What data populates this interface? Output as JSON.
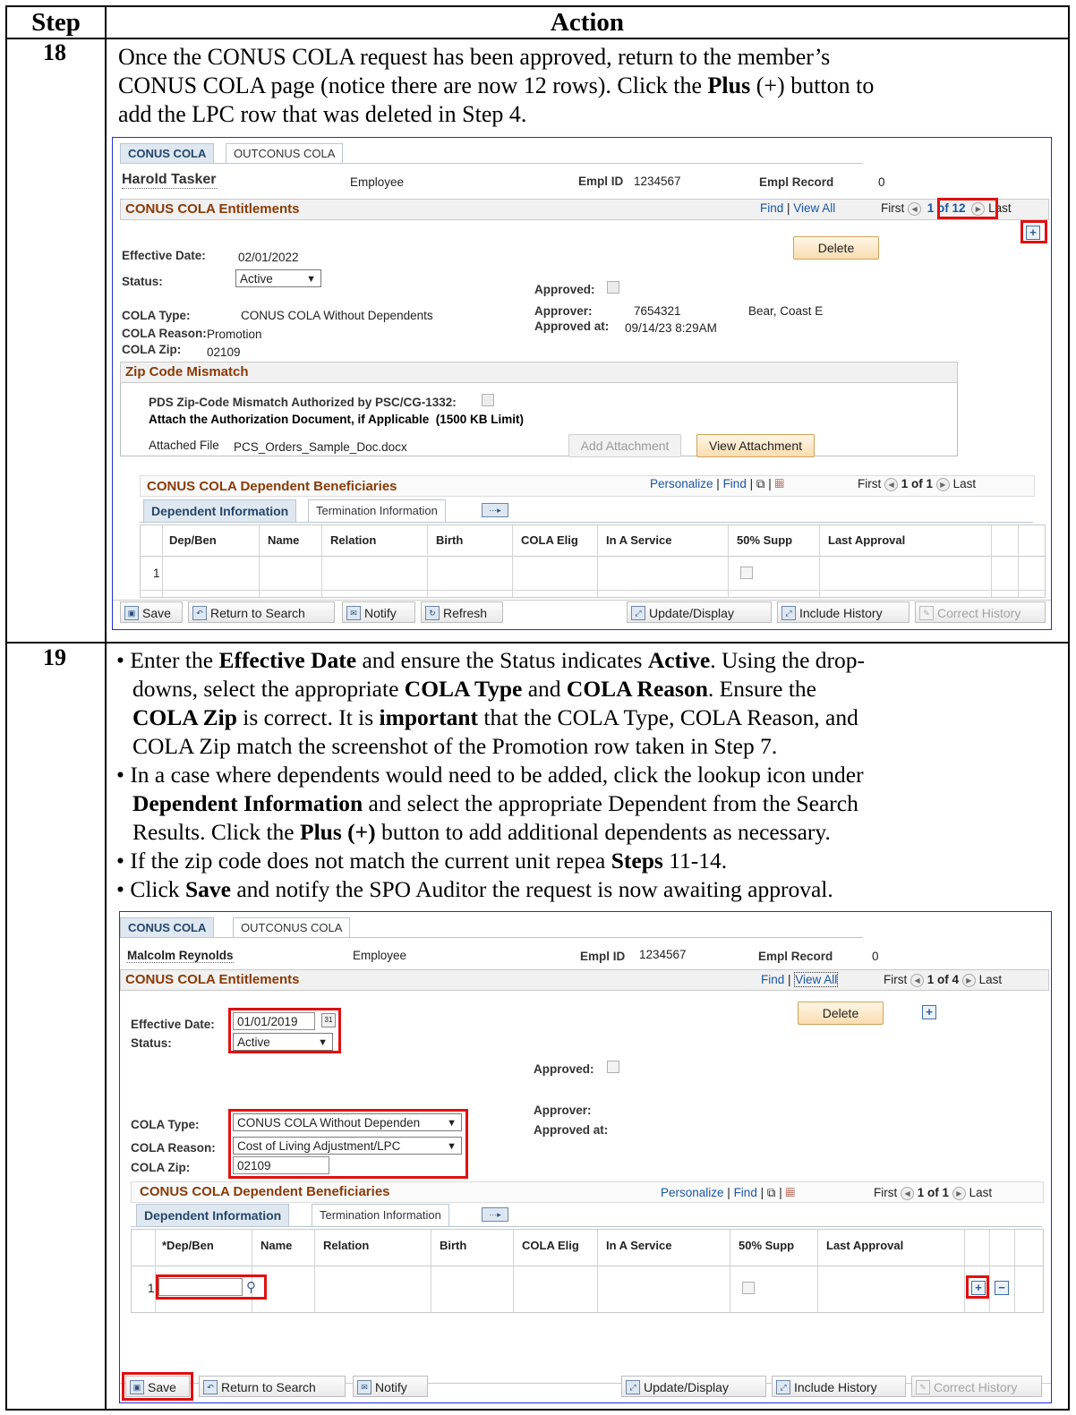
{
  "table": {
    "col_step": "Step",
    "col_action": "Action"
  },
  "step18": {
    "number": "18",
    "line1": "Once the CONUS COLA request has been approved, return to the member’s",
    "line2a": "CONUS COLA page (notice there are now 12 rows).  Click the ",
    "line2b": "Plus",
    "line2c": " (+) button to",
    "line3": "add the LPC row that was deleted in Step 4.",
    "shot": {
      "tab1": "CONUS COLA",
      "tab2": "OUTCONUS COLA",
      "name": "Harold Tasker",
      "employee": "Employee",
      "empl_id_label": "Empl ID",
      "empl_id": "1234567",
      "empl_record_label": "Empl Record",
      "empl_record": "0",
      "section_title": "CONUS COLA Entitlements",
      "find": "Find",
      "view_all": "View All",
      "first": "First",
      "counter": "1 of 12",
      "last": "Last",
      "delete": "Delete",
      "eff_date_label": "Effective Date:",
      "eff_date": "02/01/2022",
      "status_label": "Status:",
      "status": "Active",
      "approved_label": "Approved:",
      "cola_type_label": "COLA Type:",
      "cola_type": "CONUS COLA Without Dependents",
      "approver_label": "Approver:",
      "approver_id": "7654321",
      "approver_name": "Bear, Coast E",
      "cola_reason_label": "COLA Reason:",
      "cola_reason": "Promotion",
      "approved_at_label": "Approved at:",
      "approved_at": "09/14/23  8:29AM",
      "cola_zip_label": "COLA Zip:",
      "cola_zip": "02109",
      "zip_section": "Zip Code Mismatch",
      "pds_label": "PDS Zip-Code Mismatch Authorized by PSC/CG-1332:",
      "attach_doc": "Attach the Authorization Document, if Applicable",
      "kb_limit": "(1500 KB Limit)",
      "attached_file_label": "Attached File",
      "attached_file": "PCS_Orders_Sample_Doc.docx",
      "add_attachment": "Add Attachment",
      "view_attachment": "View Attachment",
      "dep_section": "CONUS COLA Dependent Beneficiaries",
      "personalize": "Personalize",
      "find2": "Find",
      "first2": "First",
      "counter2": "1 of 1",
      "last2": "Last",
      "subtab1": "Dependent Information",
      "subtab2": "Termination Information",
      "cols": [
        "Dep/Ben",
        "Name",
        "Relation",
        "Birth",
        "COLA Elig",
        "In A Service",
        "50% Supp",
        "Last Approval"
      ],
      "row_num": "1",
      "save": "Save",
      "return_to_search": "Return to Search",
      "notify": "Notify",
      "refresh": "Refresh",
      "update_display": "Update/Display",
      "include_history": "Include History",
      "correct_history": "Correct History"
    }
  },
  "step19": {
    "number": "19",
    "b1_l1a": "Enter the ",
    "b1_l1b": "Effective Date",
    "b1_l1c": " and ensure the Status indicates ",
    "b1_l1d": "Active",
    "b1_l1e": ".  Using the drop-",
    "b1_l2a": "downs, select the appropriate ",
    "b1_l2b": "COLA Type",
    "b1_l2c": " and ",
    "b1_l2d": "COLA Reason",
    "b1_l2e": ".  Ensure the",
    "b1_l3a": "COLA Zip",
    "b1_l3b": " is correct.  It is ",
    "b1_l3c": "important",
    "b1_l3d": " that the COLA Type, COLA Reason, and",
    "b1_l4": "COLA Zip match the screenshot of the Promotion row taken in Step 7.",
    "b2_l1": "In a case where dependents would need to be added, click the lookup icon under",
    "b2_l2a": "Dependent Information",
    "b2_l2b": " and select the appropriate Dependent from the Search",
    "b2_l3a": "Results.  Click the ",
    "b2_l3b": "Plus (+)",
    "b2_l3c": " button to add additional dependents as necessary.",
    "b3a": "If the zip code does not match the current unit repea ",
    "b3b": "Steps",
    "b3c": " 11-14.",
    "b4a": "Click ",
    "b4b": "Save",
    "b4c": " and notify the SPO Auditor the request is now awaiting approval.",
    "shot": {
      "tab1": "CONUS COLA",
      "tab2": "OUTCONUS COLA",
      "name": "Malcolm Reynolds",
      "employee": "Employee",
      "empl_id_label": "Empl ID",
      "empl_id": "1234567",
      "empl_record_label": "Empl Record",
      "empl_record": "0",
      "section_title": "CONUS COLA Entitlements",
      "find": "Find",
      "view_all": "View All",
      "first": "First",
      "counter": "1 of 4",
      "last": "Last",
      "delete": "Delete",
      "eff_date_label": "Effective Date:",
      "eff_date": "01/01/2019",
      "status_label": "Status:",
      "status": "Active",
      "approved_label": "Approved:",
      "approver_label": "Approver:",
      "approved_at_label": "Approved at:",
      "cola_type_label": "COLA Type:",
      "cola_type": "CONUS COLA Without Dependen",
      "cola_reason_label": "COLA Reason:",
      "cola_reason": "Cost of Living Adjustment/LPC",
      "cola_zip_label": "COLA Zip:",
      "cola_zip": "02109",
      "dep_section": "CONUS COLA Dependent Beneficiaries",
      "personalize": "Personalize",
      "find2": "Find",
      "first2": "First",
      "counter2": "1 of 1",
      "last2": "Last",
      "subtab1": "Dependent Information",
      "subtab2": "Termination Information",
      "cols": [
        "*Dep/Ben",
        "Name",
        "Relation",
        "Birth",
        "COLA Elig",
        "In A Service",
        "50% Supp",
        "Last Approval"
      ],
      "row_num": "1",
      "save": "Save",
      "return_to_search": "Return to Search",
      "notify": "Notify",
      "update_display": "Update/Display",
      "include_history": "Include History",
      "correct_history": "Correct History"
    }
  }
}
